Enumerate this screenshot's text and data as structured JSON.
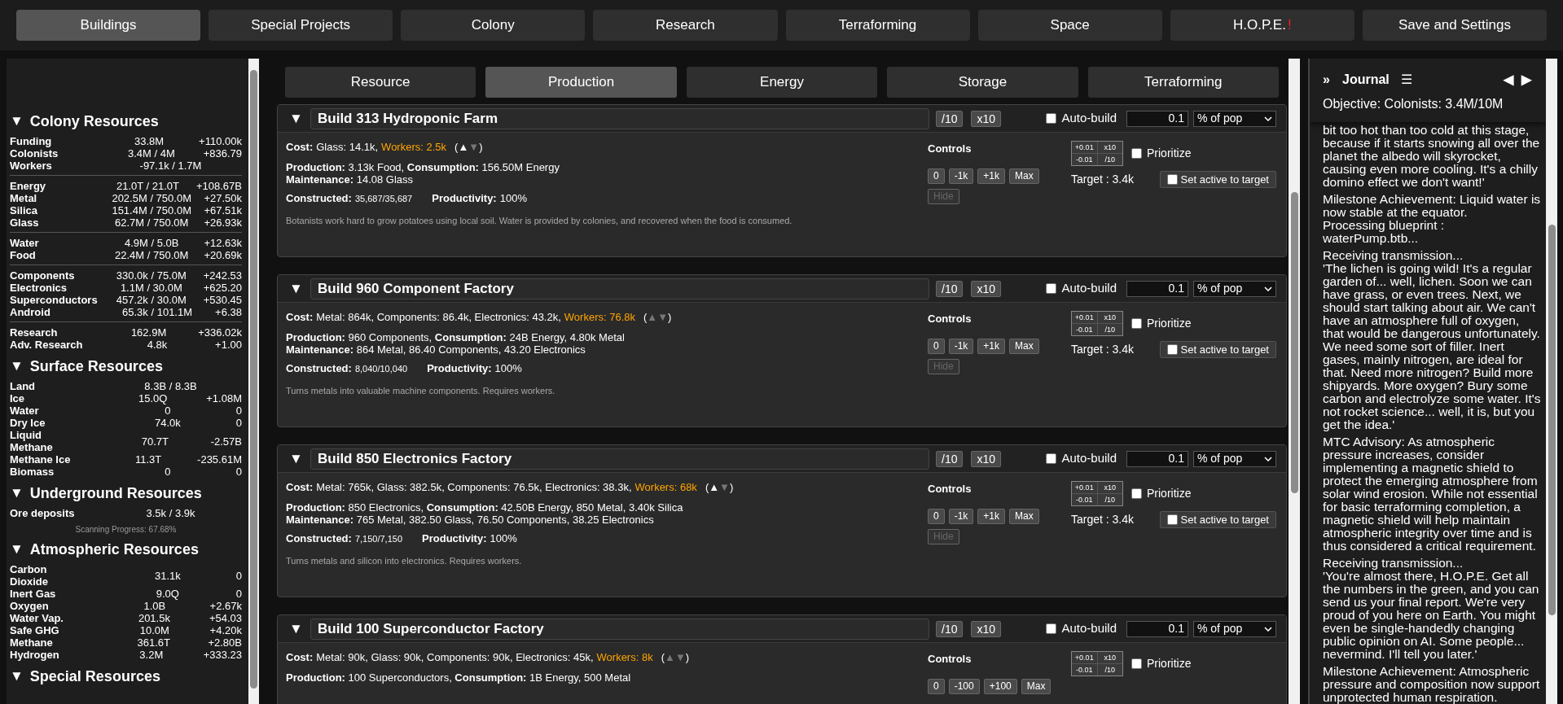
{
  "nav": [
    {
      "label": "Buildings",
      "selected": true
    },
    {
      "label": "Special Projects",
      "selected": false
    },
    {
      "label": "Colony",
      "selected": false
    },
    {
      "label": "Research",
      "selected": false
    },
    {
      "label": "Terraforming",
      "selected": false
    },
    {
      "label": "Space",
      "selected": false
    },
    {
      "label": "H.O.P.E.",
      "alert": "!",
      "selected": false
    },
    {
      "label": "Save and Settings",
      "selected": false
    }
  ],
  "sidebar": {
    "sections": [
      {
        "title": "Colony Resources",
        "collapse": "▼",
        "groups": [
          [
            {
              "name": "Funding",
              "value": "33.8M",
              "rate": "+110.00k"
            },
            {
              "name": "Colonists",
              "value": "3.4M / 4M",
              "rate": "+836.79"
            },
            {
              "name": "Workers",
              "value": "-97.1k / 1.7M"
            }
          ],
          [
            {
              "name": "Energy",
              "value": "21.0T / 21.0T",
              "rate": "+108.67B"
            },
            {
              "name": "Metal",
              "value": "202.5M / 750.0M",
              "rate": "+27.50k"
            },
            {
              "name": "Silica",
              "value": "151.4M / 750.0M",
              "rate": "+67.51k"
            },
            {
              "name": "Glass",
              "value": "62.7M / 750.0M",
              "rate": "+26.93k"
            }
          ],
          [
            {
              "name": "Water",
              "value": "4.9M / 5.0B",
              "rate": "+12.63k"
            },
            {
              "name": "Food",
              "value": "22.4M / 750.0M",
              "rate": "+20.69k"
            }
          ],
          [
            {
              "name": "Components",
              "value": "330.0k / 75.0M",
              "rate": "+242.53"
            },
            {
              "name": "Electronics",
              "value": "1.1M / 30.0M",
              "rate": "+625.20"
            },
            {
              "name": "Superconductors",
              "value": "457.2k / 30.0M",
              "rate": "+530.45"
            },
            {
              "name": "Android",
              "value": "65.3k / 101.1M",
              "rate": "+6.38"
            }
          ],
          [
            {
              "name": "Research",
              "value": "162.9M",
              "rate": "+336.02k"
            },
            {
              "name": "Adv. Research",
              "value": "4.8k",
              "rate": "+1.00"
            }
          ]
        ]
      },
      {
        "title": "Surface Resources",
        "collapse": "▼",
        "groups": [
          [
            {
              "name": "Land",
              "value": "8.3B / 8.3B"
            },
            {
              "name": "Ice",
              "value": "15.0Q",
              "rate": "+1.08M"
            },
            {
              "name": "Water",
              "value": "0",
              "rate": "0"
            },
            {
              "name": "Dry Ice",
              "value": "74.0k",
              "rate": "0"
            },
            {
              "name": "Liquid Methane",
              "value": "70.7T",
              "rate": "-2.57B"
            },
            {
              "name": "Methane Ice",
              "value": "11.3T",
              "rate": "-235.61M"
            },
            {
              "name": "Biomass",
              "value": "0",
              "rate": "0"
            }
          ]
        ]
      },
      {
        "title": "Underground Resources",
        "collapse": "▼",
        "groups": [
          [
            {
              "name": "Ore deposits",
              "value": "3.5k / 3.9k"
            }
          ]
        ],
        "note": "Scanning Progress: 67.68%"
      },
      {
        "title": "Atmospheric Resources",
        "collapse": "▼",
        "groups": [
          [
            {
              "name": "Carbon Dioxide",
              "value": "31.1k",
              "rate": "0"
            },
            {
              "name": "Inert Gas",
              "value": "9.0Q",
              "rate": "0"
            },
            {
              "name": "Oxygen",
              "value": "1.0B",
              "rate": "+2.67k"
            },
            {
              "name": "Water Vap.",
              "value": "201.5k",
              "rate": "+54.03"
            },
            {
              "name": "Safe GHG",
              "value": "10.0M",
              "rate": "+4.20k"
            },
            {
              "name": "Methane",
              "value": "361.6T",
              "rate": "+2.80B"
            },
            {
              "name": "Hydrogen",
              "value": "3.2M",
              "rate": "+333.23"
            }
          ]
        ]
      },
      {
        "title": "Special Resources",
        "collapse": "▼"
      }
    ]
  },
  "subtabs": [
    {
      "label": "Resource",
      "selected": false
    },
    {
      "label": "Production",
      "selected": true
    },
    {
      "label": "Energy",
      "selected": false
    },
    {
      "label": "Storage",
      "selected": false
    },
    {
      "label": "Terraforming",
      "selected": false
    }
  ],
  "cards": [
    {
      "collapse": "▼",
      "title": "Build 313 Hydroponic Farm",
      "divide": "/10",
      "multiply": "x10",
      "auto_build": {
        "label": "Auto-build",
        "checked": false,
        "value": "0.1",
        "mode": "% of pop"
      },
      "cost_label": "Cost:",
      "cost": "Glass: 14.1k,",
      "workers": "Workers: 2.5k",
      "arrows_open": "(",
      "arrows_close": ")",
      "arrows": [
        {
          "glyph": "▲",
          "active": true
        },
        {
          "glyph": "▼",
          "active": false
        }
      ],
      "production": "**Production:** 3.13k Food, **Consumption:** 156.50M Energy",
      "maintenance": "**Maintenance:** 14.08 Glass",
      "constructed_label": "Constructed:",
      "constructed": "35,687/35,687",
      "productivity_label": "Productivity:",
      "productivity": "100%",
      "description": "Botanists work hard to grow potatoes using local soil. Water is provided by colonies, and recovered when the food is consumed.",
      "controls_label": "Controls",
      "controls": [
        "0",
        "-1k",
        "+1k",
        "Max"
      ],
      "hide": {
        "label": "Hide",
        "disabled": true
      },
      "steps": [
        "+0.01",
        "x10",
        "-0.01",
        "/10"
      ],
      "prioritize": {
        "label": "Prioritize",
        "checked": false
      },
      "target": "Target : 3.4k",
      "set_active": {
        "label": "Set active to target",
        "checked": false
      }
    },
    {
      "collapse": "▼",
      "title": "Build 960 Component Factory",
      "divide": "/10",
      "multiply": "x10",
      "auto_build": {
        "label": "Auto-build",
        "checked": false,
        "value": "0.1",
        "mode": "% of pop"
      },
      "cost_label": "Cost:",
      "cost": "Metal: 864k, Components: 86.4k, Electronics: 43.2k,",
      "workers": "Workers: 76.8k",
      "arrows_open": "(",
      "arrows_close": ")",
      "arrows": [
        {
          "glyph": "▲",
          "active": false
        },
        {
          "glyph": "▼",
          "active": false
        }
      ],
      "production": "**Production:** 960 Components, **Consumption:** 24B Energy, 4.80k Metal",
      "maintenance": "**Maintenance:** 864 Metal, 86.40 Components, 43.20 Electronics",
      "constructed_label": "Constructed:",
      "constructed": "8,040/10,040",
      "productivity_label": "Productivity:",
      "productivity": "100%",
      "description": "Turns metals into valuable machine components. Requires workers.",
      "controls_label": "Controls",
      "controls": [
        "0",
        "-1k",
        "+1k",
        "Max"
      ],
      "hide": {
        "label": "Hide",
        "disabled": true
      },
      "steps": [
        "+0.01",
        "x10",
        "-0.01",
        "/10"
      ],
      "prioritize": {
        "label": "Prioritize",
        "checked": false
      },
      "target": "Target : 3.4k",
      "set_active": {
        "label": "Set active to target",
        "checked": false
      }
    },
    {
      "collapse": "▼",
      "title": "Build 850 Electronics Factory",
      "divide": "/10",
      "multiply": "x10",
      "auto_build": {
        "label": "Auto-build",
        "checked": false,
        "value": "0.1",
        "mode": "% of pop"
      },
      "cost_label": "Cost:",
      "cost": "Metal: 765k, Glass: 382.5k, Components: 76.5k, Electronics: 38.3k,",
      "workers": "Workers: 68k",
      "arrows_open": "(",
      "arrows_close": ")",
      "arrows": [
        {
          "glyph": "▲",
          "active": true
        },
        {
          "glyph": "▼",
          "active": false
        }
      ],
      "production": "**Production:** 850 Electronics, **Consumption:** 42.50B Energy, 850 Metal, 3.40k Silica",
      "maintenance": "**Maintenance:** 765 Metal, 382.50 Glass, 76.50 Components, 38.25 Electronics",
      "constructed_label": "Constructed:",
      "constructed": "7,150/7,150",
      "productivity_label": "Productivity:",
      "productivity": "100%",
      "description": "Turns metals and silicon into electronics. Requires workers.",
      "controls_label": "Controls",
      "controls": [
        "0",
        "-1k",
        "+1k",
        "Max"
      ],
      "hide": {
        "label": "Hide",
        "disabled": true
      },
      "steps": [
        "+0.01",
        "x10",
        "-0.01",
        "/10"
      ],
      "prioritize": {
        "label": "Prioritize",
        "checked": false
      },
      "target": "Target : 3.4k",
      "set_active": {
        "label": "Set active to target",
        "checked": false
      }
    },
    {
      "collapse": "▼",
      "title": "Build 100 Superconductor Factory",
      "divide": "/10",
      "multiply": "x10",
      "auto_build": {
        "label": "Auto-build",
        "checked": false,
        "value": "0.1",
        "mode": "% of pop"
      },
      "cost_label": "Cost:",
      "cost": "Metal: 90k, Glass: 90k, Components: 90k, Electronics: 45k,",
      "workers": "Workers: 8k",
      "arrows_open": "(",
      "arrows_close": ")",
      "arrows": [
        {
          "glyph": "▲",
          "active": false
        },
        {
          "glyph": "▼",
          "active": false
        }
      ],
      "production": "**Production:** 100 Superconductors, **Consumption:** 1B Energy, 500 Metal",
      "controls_label": "Controls",
      "controls": [
        "0",
        "-100",
        "+100",
        "Max"
      ],
      "steps": [
        "+0.01",
        "x10",
        "-0.01",
        "/10"
      ],
      "prioritize": {
        "label": "Prioritize",
        "checked": false
      }
    }
  ],
  "journal": {
    "collapse": "»",
    "title": "Journal",
    "menu": "☰",
    "prev": "◀",
    "next": "▶",
    "objective": "Objective: Colonists: 3.4M/10M",
    "entries": [
      [
        "bit too hot than too cold at this stage, because if it starts snowing all over the planet the albedo will skyrocket, causing even more cooling. It's a chilly domino effect we don't want!'"
      ],
      [
        "Milestone Achievement: Liquid water is now stable at the equator.",
        "Processing blueprint : waterPump.btb..."
      ],
      [
        "Receiving transmission...",
        "'The lichen is going wild! It's a regular garden of... well, lichen. Soon we can have grass, or even trees. Next, we should start talking about air. We can't have an atmosphere full of oxygen, that would be dangerous unfortunately. We need some sort of filler. Inert gases, mainly nitrogen, are ideal for that. Need more nitrogen? Build more shipyards. More oxygen? Bury some carbon and electrolyze some water. It's not rocket science... well, it is, but you get the idea.'"
      ],
      [
        "MTC Advisory: As atmospheric pressure increases, consider implementing a magnetic shield to protect the emerging atmosphere from solar wind erosion. While not essential for basic terraforming completion, a magnetic shield will help maintain atmospheric integrity over time and is thus considered a critical requirement."
      ],
      [
        "Receiving transmission...",
        "'You're almost there, H.O.P.E. Get all the numbers in the green, and you can send us your final report. We're very proud of you here on Earth. You might even be single-handedly changing public opinion on AI. Some people... nevermind. I'll tell you later.'"
      ],
      [
        "Milestone Achievement: Atmospheric pressure and composition now support unprotected human respiration."
      ]
    ]
  }
}
